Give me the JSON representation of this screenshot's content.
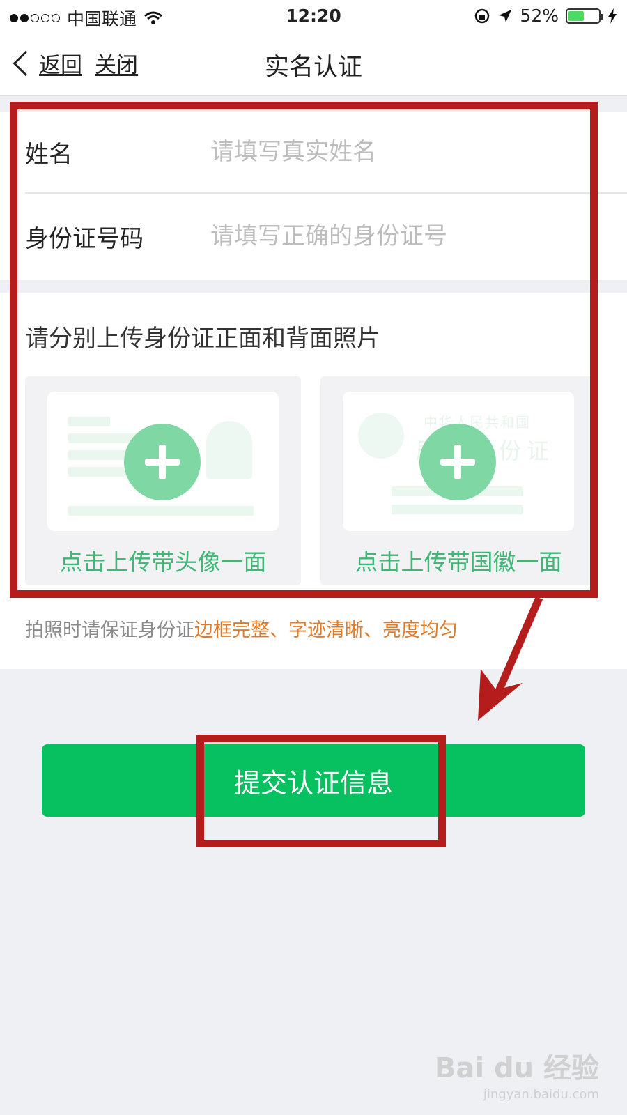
{
  "status_bar": {
    "carrier": "中国联通",
    "time": "12:20",
    "battery": "52%",
    "battery_level": 0.52
  },
  "nav": {
    "back_label": "返回",
    "close_label": "关闭",
    "title": "实名认证"
  },
  "form": {
    "name_label": "姓名",
    "name_placeholder": "请填写真实姓名",
    "id_label": "身份证号码",
    "id_placeholder": "请填写正确的身份证号"
  },
  "upload": {
    "hint": "请分别上传身份证正面和背面照片",
    "front_caption": "点击上传带头像一面",
    "back_caption": "点击上传带国徽一面",
    "back_card_line1": "中华人民共和国",
    "back_card_line2": "居民身份证"
  },
  "note": {
    "prefix": "拍照时请保证身份证",
    "highlight": "边框完整、字迹清晰、亮度均匀"
  },
  "submit_label": "提交认证信息",
  "watermark": {
    "brand": "Bai du 经验",
    "url": "jingyan.baidu.com"
  },
  "colors": {
    "accent": "#07c160",
    "upload_green": "#3fb877",
    "warning": "#e07b2a",
    "annotation": "#b51d1d"
  }
}
